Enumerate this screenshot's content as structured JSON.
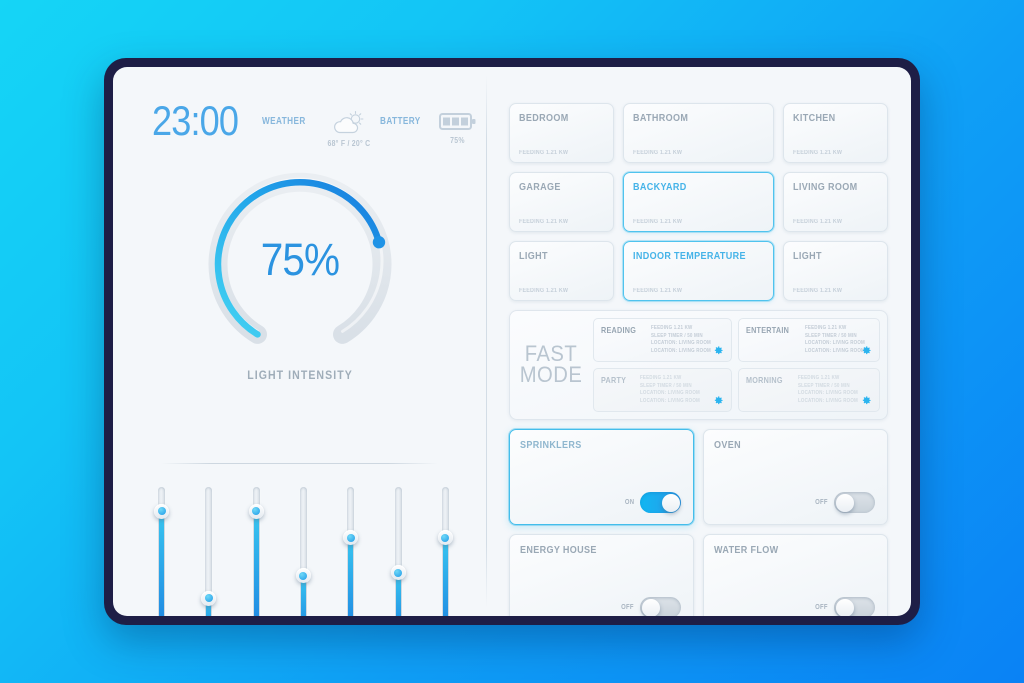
{
  "status": {
    "clock": "23:00",
    "weather_label": "WEATHER",
    "weather_temp": "68° F / 20° C",
    "battery_label": "BATTERY",
    "battery_pct": "75%"
  },
  "gauge": {
    "value": "75%",
    "percent": 75,
    "caption": "LIGHT INTENSITY",
    "arc_color_start": "#3ed0f2",
    "arc_color_end": "#1a7fe0"
  },
  "sliders": [
    {
      "name": "slider-1",
      "value": 88
    },
    {
      "name": "slider-2",
      "value": 26
    },
    {
      "name": "slider-3",
      "value": 88
    },
    {
      "name": "slider-4",
      "value": 42
    },
    {
      "name": "slider-5",
      "value": 69
    },
    {
      "name": "slider-6",
      "value": 44
    },
    {
      "name": "slider-7",
      "value": 69
    }
  ],
  "rooms": [
    {
      "title": "BEDROOM",
      "sub": "FEEDING 1.21 KW",
      "active": false
    },
    {
      "title": "BATHROOM",
      "sub": "FEEDING 1.21 KW",
      "active": false
    },
    {
      "title": "KITCHEN",
      "sub": "FEEDING 1.21 KW",
      "active": false
    },
    {
      "title": "GARAGE",
      "sub": "FEEDING 1.21 KW",
      "active": false
    },
    {
      "title": "BACKYARD",
      "sub": "FEEDING 1.21 KW",
      "active": true
    },
    {
      "title": "LIVING ROOM",
      "sub": "FEEDING 1.21 KW",
      "active": false
    },
    {
      "title": "LIGHT",
      "sub": "FEEDING 1.21 KW",
      "active": false
    },
    {
      "title": "INDOOR TEMPERATURE",
      "sub": "FEEDING 1.21 KW",
      "active": true
    },
    {
      "title": "LIGHT",
      "sub": "FEEDING 1.21 KW",
      "active": false
    }
  ],
  "fast_mode": {
    "label_line1": "FAST",
    "label_line2": "MODE",
    "modes": [
      {
        "name": "READING",
        "dim": false,
        "lines": [
          "FEEDING 1.21 KW",
          "SLEEP TIMER / 50 MIN",
          "LOCATION: LIVING ROOM",
          "LOCATION: LIVING ROOM"
        ]
      },
      {
        "name": "ENTERTAIN",
        "dim": false,
        "lines": [
          "FEEDING 1.21 KW",
          "SLEEP TIMER / 50 MIN",
          "LOCATION: LIVING ROOM",
          "LOCATION: LIVING ROOM"
        ]
      },
      {
        "name": "PARTY",
        "dim": true,
        "lines": [
          "FEEDING 1.21 KW",
          "SLEEP TIMER / 50 MIN",
          "LOCATION: LIVING ROOM",
          "LOCATION: LIVING ROOM"
        ]
      },
      {
        "name": "MORNING",
        "dim": true,
        "lines": [
          "FEEDING 1.21 KW",
          "SLEEP TIMER / 50 MIN",
          "LOCATION: LIVING ROOM",
          "LOCATION: LIVING ROOM"
        ]
      }
    ],
    "gear_icon": "gear-icon",
    "gear_color": "#2bb4ef"
  },
  "toggles": [
    {
      "title": "SPRINKLERS",
      "state": "ON",
      "on": true,
      "active": true
    },
    {
      "title": "OVEN",
      "state": "OFF",
      "on": false,
      "active": false
    },
    {
      "title": "ENERGY HOUSE",
      "state": "OFF",
      "on": false,
      "active": false
    },
    {
      "title": "WATER FLOW",
      "state": "OFF",
      "on": false,
      "active": false
    }
  ],
  "icons": {
    "weather": "partly-cloudy-icon",
    "battery": "battery-icon"
  }
}
